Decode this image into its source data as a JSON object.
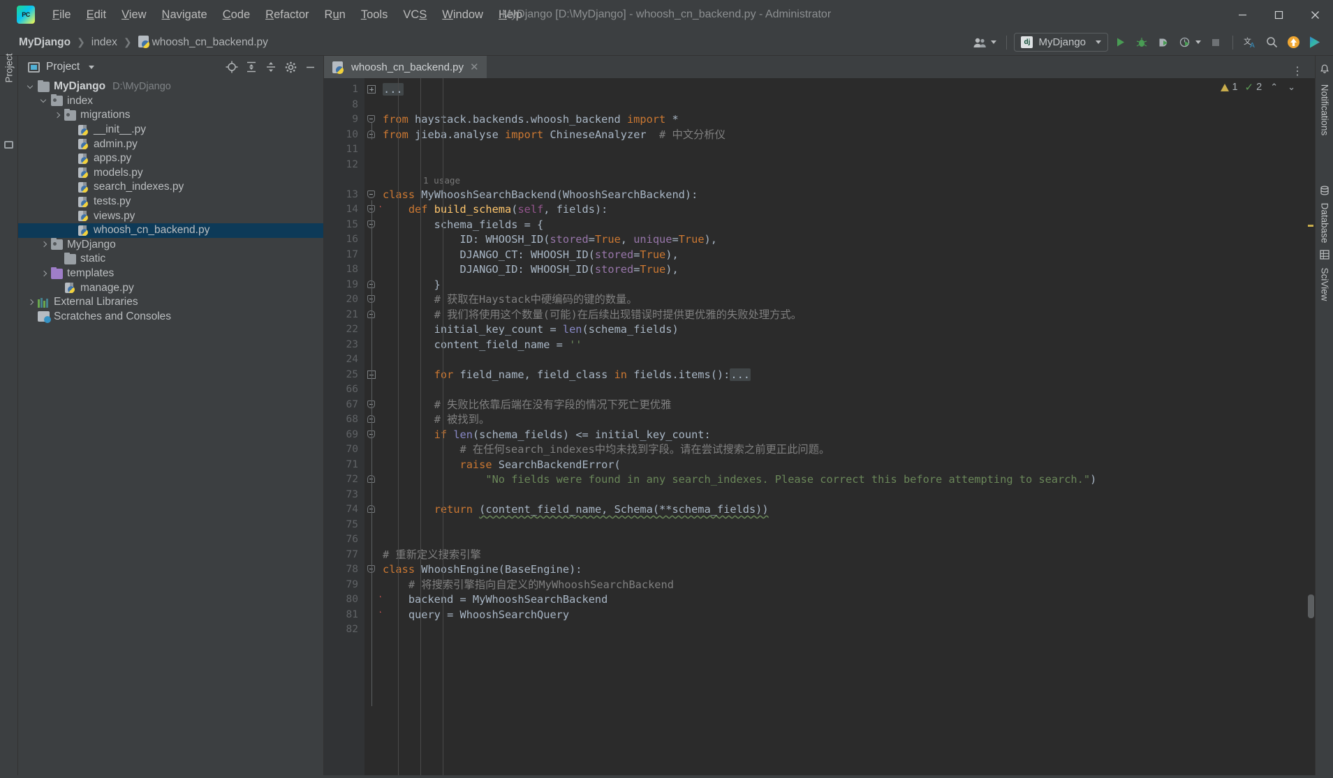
{
  "window": {
    "title": "MyDjango [D:\\MyDjango] - whoosh_cn_backend.py - Administrator",
    "minimize": "—",
    "maximize": "▢",
    "close": "✕"
  },
  "menubar": {
    "logo": "pycharm-logo",
    "items": [
      {
        "label": "File",
        "mnemonic": "F"
      },
      {
        "label": "Edit",
        "mnemonic": "E"
      },
      {
        "label": "View",
        "mnemonic": "V"
      },
      {
        "label": "Navigate",
        "mnemonic": "N"
      },
      {
        "label": "Code",
        "mnemonic": "C"
      },
      {
        "label": "Refactor",
        "mnemonic": "R"
      },
      {
        "label": "Run",
        "mnemonic": "u"
      },
      {
        "label": "Tools",
        "mnemonic": "T"
      },
      {
        "label": "VCS",
        "mnemonic": "S"
      },
      {
        "label": "Window",
        "mnemonic": "W"
      },
      {
        "label": "Help",
        "mnemonic": "H"
      }
    ]
  },
  "breadcrumbs": [
    {
      "label": "MyDjango",
      "bold": true,
      "icon": ""
    },
    {
      "label": "index",
      "bold": false,
      "icon": ""
    },
    {
      "label": "whoosh_cn_backend.py",
      "bold": false,
      "icon": "python-file-icon"
    }
  ],
  "toolbar": {
    "profile_icon": "user-profile-icon",
    "run_config": {
      "label": "MyDjango",
      "badge": "dj"
    },
    "buttons": [
      {
        "name": "run-button",
        "glyph": "▶"
      },
      {
        "name": "debug-button",
        "glyph": "🐞"
      },
      {
        "name": "run-with-coverage-button",
        "glyph": "▣"
      },
      {
        "name": "profile-button",
        "glyph": "◔"
      },
      {
        "name": "stop-button",
        "glyph": "■"
      },
      {
        "name": "translate-button",
        "glyph": "文"
      },
      {
        "name": "search-everywhere-button",
        "glyph": "🔍"
      },
      {
        "name": "update-button",
        "glyph": "↑"
      },
      {
        "name": "ide-feature-button",
        "glyph": "▷"
      }
    ]
  },
  "left_rail": {
    "label": "Project"
  },
  "right_rail": {
    "items": [
      {
        "label": "Notifications",
        "icon": "bell-icon"
      },
      {
        "label": "Database",
        "icon": "database-icon"
      },
      {
        "label": "SciView",
        "icon": "grid-icon"
      }
    ]
  },
  "project_panel": {
    "title": "Project",
    "tools": [
      {
        "name": "select-opened-file-button",
        "glyph": "⊕"
      },
      {
        "name": "expand-all-button",
        "glyph": "⇲"
      },
      {
        "name": "collapse-all-button",
        "glyph": "⇱"
      },
      {
        "name": "settings-button",
        "glyph": "⚙"
      },
      {
        "name": "hide-button",
        "glyph": "—"
      }
    ],
    "tree": [
      {
        "label": "MyDjango",
        "path": "D:\\MyDjango",
        "indent": 0,
        "arrow": "down",
        "icon": "folder",
        "bold": true,
        "selected": false
      },
      {
        "label": "index",
        "path": "",
        "indent": 1,
        "arrow": "down",
        "icon": "folder-source",
        "bold": false,
        "selected": false
      },
      {
        "label": "migrations",
        "path": "",
        "indent": 2,
        "arrow": "right",
        "icon": "folder-source",
        "bold": false,
        "selected": false
      },
      {
        "label": "__init__.py",
        "path": "",
        "indent": 3,
        "arrow": "none",
        "icon": "python",
        "bold": false,
        "selected": false
      },
      {
        "label": "admin.py",
        "path": "",
        "indent": 3,
        "arrow": "none",
        "icon": "python",
        "bold": false,
        "selected": false
      },
      {
        "label": "apps.py",
        "path": "",
        "indent": 3,
        "arrow": "none",
        "icon": "python",
        "bold": false,
        "selected": false
      },
      {
        "label": "models.py",
        "path": "",
        "indent": 3,
        "arrow": "none",
        "icon": "python",
        "bold": false,
        "selected": false
      },
      {
        "label": "search_indexes.py",
        "path": "",
        "indent": 3,
        "arrow": "none",
        "icon": "python",
        "bold": false,
        "selected": false
      },
      {
        "label": "tests.py",
        "path": "",
        "indent": 3,
        "arrow": "none",
        "icon": "python",
        "bold": false,
        "selected": false
      },
      {
        "label": "views.py",
        "path": "",
        "indent": 3,
        "arrow": "none",
        "icon": "python",
        "bold": false,
        "selected": false
      },
      {
        "label": "whoosh_cn_backend.py",
        "path": "",
        "indent": 3,
        "arrow": "none",
        "icon": "python",
        "bold": false,
        "selected": true
      },
      {
        "label": "MyDjango",
        "path": "",
        "indent": 1,
        "arrow": "right",
        "icon": "folder-source",
        "bold": false,
        "selected": false
      },
      {
        "label": "static",
        "path": "",
        "indent": 2,
        "arrow": "none",
        "icon": "folder",
        "bold": false,
        "selected": false
      },
      {
        "label": "templates",
        "path": "",
        "indent": 1,
        "arrow": "right",
        "icon": "folder-templates",
        "bold": false,
        "selected": false
      },
      {
        "label": "manage.py",
        "path": "",
        "indent": 2,
        "arrow": "none",
        "icon": "python",
        "bold": false,
        "selected": false
      },
      {
        "label": "External Libraries",
        "path": "",
        "indent": 0,
        "arrow": "right",
        "icon": "library",
        "bold": false,
        "selected": false
      },
      {
        "label": "Scratches and Consoles",
        "path": "",
        "indent": 0,
        "arrow": "none",
        "icon": "scratch",
        "bold": false,
        "selected": false
      }
    ]
  },
  "editor": {
    "tab": {
      "label": "whoosh_cn_backend.py",
      "close": "✕",
      "icon": "python-file-icon"
    },
    "kebab": "⋮",
    "inspections": {
      "warning_count": "1",
      "ok_count": "2",
      "prev": "⌃",
      "next": "⌄"
    },
    "usage_hint": "1 usage",
    "lines": [
      {
        "num": "1",
        "fold": "plus",
        "html": "<span class=\"dots\">...</span>"
      },
      {
        "num": "8",
        "fold": "",
        "html": ""
      },
      {
        "num": "9",
        "fold": "top",
        "html": "<span class=\"kw\">from</span> haystack.backends.whoosh_backend <span class=\"kw\">import</span> *"
      },
      {
        "num": "10",
        "fold": "bot",
        "html": "<span class=\"kw\">from</span> jieba.analyse <span class=\"kw\">import</span> ChineseAnalyzer  <span class=\"cmt\"># 中文分析仪</span>"
      },
      {
        "num": "11",
        "fold": "",
        "html": ""
      },
      {
        "num": "12",
        "fold": "",
        "html": ""
      },
      {
        "num": "13",
        "fold": "top",
        "html": "<span class=\"kw\">class</span> <span class=\"cls\">MyWhooshSearchBackend</span>(WhooshSearchBackend):",
        "usage": true
      },
      {
        "num": "14",
        "fold": "top",
        "html": "    <span class=\"kw\">def</span> <span class=\"fn\">build_schema</span>(<span class=\"self\">self</span>, fields):",
        "gutter_mark": true
      },
      {
        "num": "15",
        "fold": "top",
        "html": "        schema_fields = {"
      },
      {
        "num": "16",
        "fold": "",
        "html": "            ID: WHOOSH_ID(<span class=\"cnst\">stored</span>=<span class=\"kw\">True</span>, <span class=\"cnst\">unique</span>=<span class=\"kw\">True</span>),"
      },
      {
        "num": "17",
        "fold": "",
        "html": "            DJANGO_CT: WHOOSH_ID(<span class=\"cnst\">stored</span>=<span class=\"kw\">True</span>),"
      },
      {
        "num": "18",
        "fold": "",
        "html": "            DJANGO_ID: WHOOSH_ID(<span class=\"cnst\">stored</span>=<span class=\"kw\">True</span>),"
      },
      {
        "num": "19",
        "fold": "bot",
        "html": "        }"
      },
      {
        "num": "20",
        "fold": "top",
        "html": "        <span class=\"cmt\"># 获取在Haystack中硬编码的键的数量。</span>"
      },
      {
        "num": "21",
        "fold": "bot",
        "html": "        <span class=\"cmt\"># 我们将使用这个数量(可能)在后续出现错误时提供更优雅的失败处理方式。</span>"
      },
      {
        "num": "22",
        "fold": "",
        "html": "        initial_key_count = <span class=\"bi\">len</span>(schema_fields)"
      },
      {
        "num": "23",
        "fold": "",
        "html": "        content_field_name = <span class=\"str\">''</span>"
      },
      {
        "num": "24",
        "fold": "",
        "html": ""
      },
      {
        "num": "25",
        "fold": "plus",
        "html": "        <span class=\"kw\">for</span> field_name, field_class <span class=\"kw\">in</span> fields.items():<span class=\"dots\">...</span>"
      },
      {
        "num": "66",
        "fold": "",
        "html": ""
      },
      {
        "num": "67",
        "fold": "top",
        "html": "        <span class=\"cmt\"># 失败比依靠后端在没有字段的情况下死亡更优雅</span>"
      },
      {
        "num": "68",
        "fold": "bot",
        "html": "        <span class=\"cmt\"># 被找到。</span>"
      },
      {
        "num": "69",
        "fold": "top",
        "html": "        <span class=\"kw\">if</span> <span class=\"bi\">len</span>(schema_fields) &lt;= initial_key_count:"
      },
      {
        "num": "70",
        "fold": "",
        "html": "            <span class=\"cmt\"># 在任何search_indexes中均未找到字段。请在尝试搜索之前更正此问题。</span>"
      },
      {
        "num": "71",
        "fold": "",
        "html": "            <span class=\"kw\">raise</span> SearchBackendError("
      },
      {
        "num": "72",
        "fold": "bot",
        "html": "                <span class=\"str\">\"No fields were found in any search_indexes. Please correct this before attempting to search.\"</span>)"
      },
      {
        "num": "73",
        "fold": "",
        "html": ""
      },
      {
        "num": "74",
        "fold": "bot",
        "html": "        <span class=\"kw\">return</span> <span class=\"sqg\">(content_field_name, Schema(**schema_fields))</span>"
      },
      {
        "num": "75",
        "fold": "",
        "html": ""
      },
      {
        "num": "76",
        "fold": "",
        "html": ""
      },
      {
        "num": "77",
        "fold": "",
        "html": "<span class=\"cmt\"># 重新定义搜索引擎</span>"
      },
      {
        "num": "78",
        "fold": "top",
        "html": "<span class=\"kw\">class</span> <span class=\"cls\">WhooshEngine</span>(BaseEngine):"
      },
      {
        "num": "79",
        "fold": "",
        "html": "    <span class=\"cmt\"># 将搜索引擎指向自定义的MyWhooshSearchBackend</span>"
      },
      {
        "num": "80",
        "fold": "",
        "html": "    backend = MyWhooshSearchBackend",
        "gutter_mark": true
      },
      {
        "num": "81",
        "fold": "",
        "html": "    query = WhooshSearchQuery",
        "gutter_mark": true
      },
      {
        "num": "82",
        "fold": "",
        "html": ""
      }
    ]
  },
  "colors": {
    "accent_selection": "#0d3a58",
    "keyword": "#cc7832",
    "string": "#6a8759",
    "comment": "#808080",
    "function": "#ffc66d",
    "number": "#6897bb",
    "editor_bg": "#2b2b2b",
    "chrome_bg": "#3c3f41"
  }
}
